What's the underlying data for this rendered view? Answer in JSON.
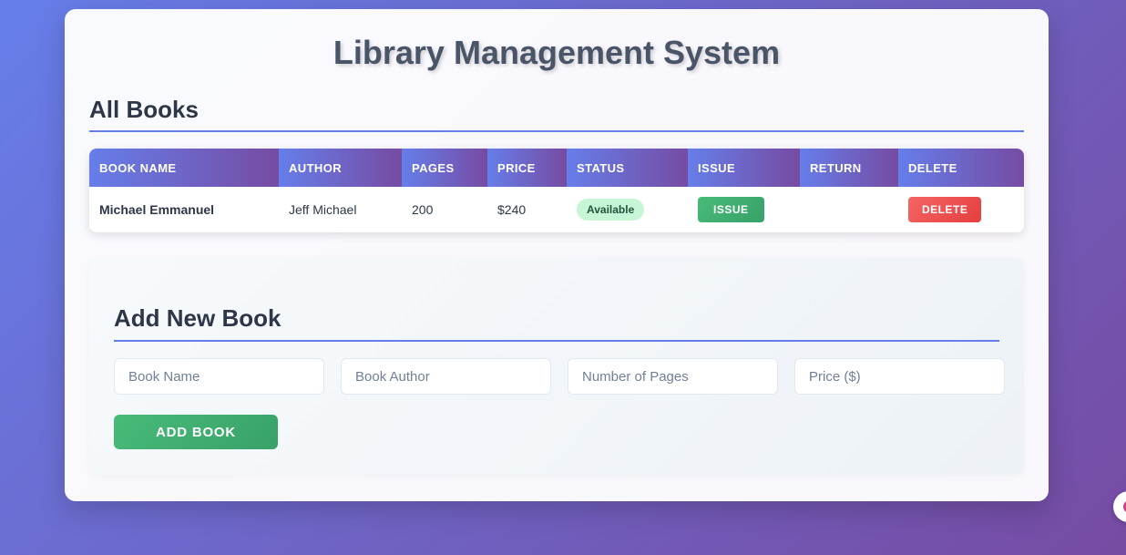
{
  "header": {
    "title": "Library Management System"
  },
  "books_section": {
    "title": "All Books",
    "columns": [
      "BOOK NAME",
      "AUTHOR",
      "PAGES",
      "PRICE",
      "STATUS",
      "ISSUE",
      "RETURN",
      "DELETE"
    ],
    "rows": [
      {
        "name": "Michael Emmanuel",
        "author": "Jeff Michael",
        "pages": "200",
        "price": "$240",
        "status": "Available",
        "issue_label": "ISSUE",
        "delete_label": "DELETE"
      }
    ]
  },
  "form": {
    "title": "Add New Book",
    "name_placeholder": "Book Name",
    "author_placeholder": "Book Author",
    "pages_placeholder": "Number of Pages",
    "price_placeholder": "Price ($)",
    "submit_label": "ADD BOOK"
  },
  "colors": {
    "accent_start": "#667eea",
    "accent_end": "#764ba2",
    "success": "#48bb78",
    "danger": "#f56565"
  }
}
